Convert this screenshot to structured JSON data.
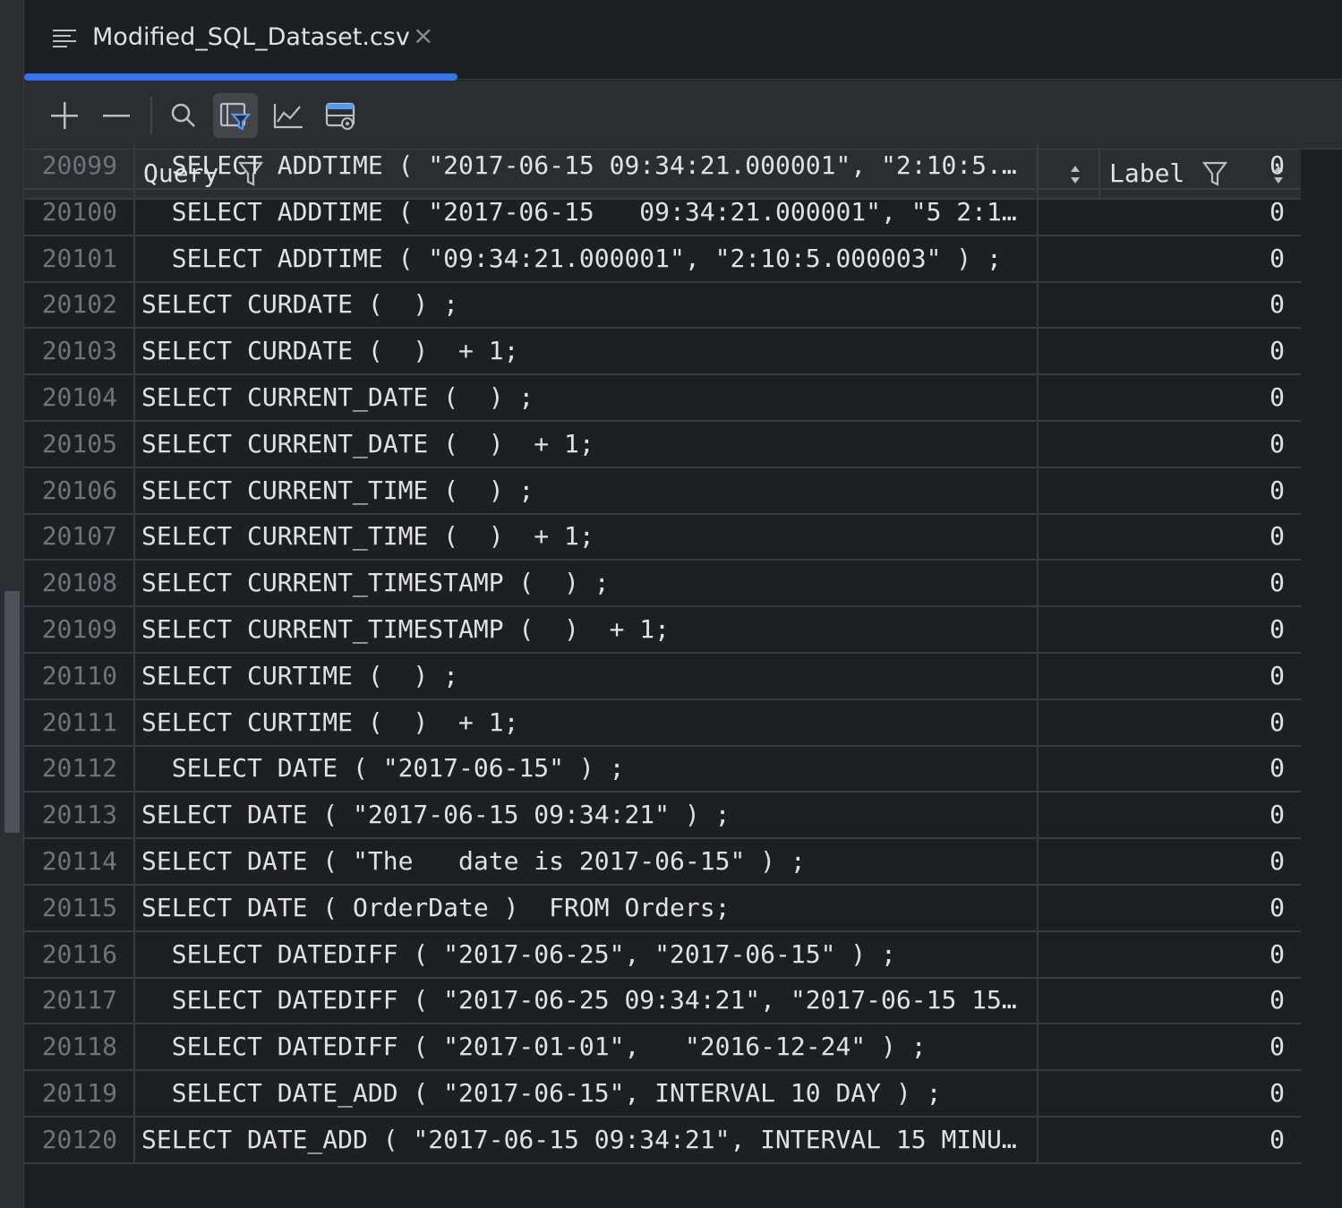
{
  "tab": {
    "title": "Modified_SQL_Dataset.csv",
    "close": "×"
  },
  "toolbar": {
    "buttons": [
      "add-row",
      "remove-row",
      "search",
      "filter",
      "chart",
      "view-settings"
    ],
    "active": "filter"
  },
  "columns": {
    "query": "Query",
    "label": "Label"
  },
  "colors": {
    "accent": "#3574f0",
    "background": "#1e1f22",
    "panel": "#2b2d30"
  },
  "rows": [
    {
      "num": "20099",
      "query": "  SELECT ADDTIME ( \"2017-06-15 09:34:21.000001\", \"2:10:5.…",
      "label": "0"
    },
    {
      "num": "20100",
      "query": "  SELECT ADDTIME ( \"2017-06-15   09:34:21.000001\", \"5 2:1…",
      "label": "0"
    },
    {
      "num": "20101",
      "query": "  SELECT ADDTIME ( \"09:34:21.000001\", \"2:10:5.000003\" ) ;",
      "label": "0"
    },
    {
      "num": "20102",
      "query": "SELECT CURDATE (  ) ;",
      "label": "0"
    },
    {
      "num": "20103",
      "query": "SELECT CURDATE (  )  + 1;",
      "label": "0"
    },
    {
      "num": "20104",
      "query": "SELECT CURRENT_DATE (  ) ;",
      "label": "0"
    },
    {
      "num": "20105",
      "query": "SELECT CURRENT_DATE (  )  + 1;",
      "label": "0"
    },
    {
      "num": "20106",
      "query": "SELECT CURRENT_TIME (  ) ;",
      "label": "0"
    },
    {
      "num": "20107",
      "query": "SELECT CURRENT_TIME (  )  + 1;",
      "label": "0"
    },
    {
      "num": "20108",
      "query": "SELECT CURRENT_TIMESTAMP (  ) ;",
      "label": "0"
    },
    {
      "num": "20109",
      "query": "SELECT CURRENT_TIMESTAMP (  )  + 1;",
      "label": "0"
    },
    {
      "num": "20110",
      "query": "SELECT CURTIME (  ) ;",
      "label": "0"
    },
    {
      "num": "20111",
      "query": "SELECT CURTIME (  )  + 1;",
      "label": "0"
    },
    {
      "num": "20112",
      "query": "  SELECT DATE ( \"2017-06-15\" ) ;",
      "label": "0"
    },
    {
      "num": "20113",
      "query": "SELECT DATE ( \"2017-06-15 09:34:21\" ) ;",
      "label": "0"
    },
    {
      "num": "20114",
      "query": "SELECT DATE ( \"The   date is 2017-06-15\" ) ;",
      "label": "0"
    },
    {
      "num": "20115",
      "query": "SELECT DATE ( OrderDate )  FROM Orders;",
      "label": "0"
    },
    {
      "num": "20116",
      "query": "  SELECT DATEDIFF ( \"2017-06-25\", \"2017-06-15\" ) ;",
      "label": "0"
    },
    {
      "num": "20117",
      "query": "  SELECT DATEDIFF ( \"2017-06-25 09:34:21\", \"2017-06-15 15…",
      "label": "0"
    },
    {
      "num": "20118",
      "query": "  SELECT DATEDIFF ( \"2017-01-01\",   \"2016-12-24\" ) ;",
      "label": "0"
    },
    {
      "num": "20119",
      "query": "  SELECT DATE_ADD ( \"2017-06-15\", INTERVAL 10 DAY ) ;",
      "label": "0"
    },
    {
      "num": "20120",
      "query": "SELECT DATE_ADD ( \"2017-06-15 09:34:21\", INTERVAL 15 MINU…",
      "label": "0"
    }
  ]
}
